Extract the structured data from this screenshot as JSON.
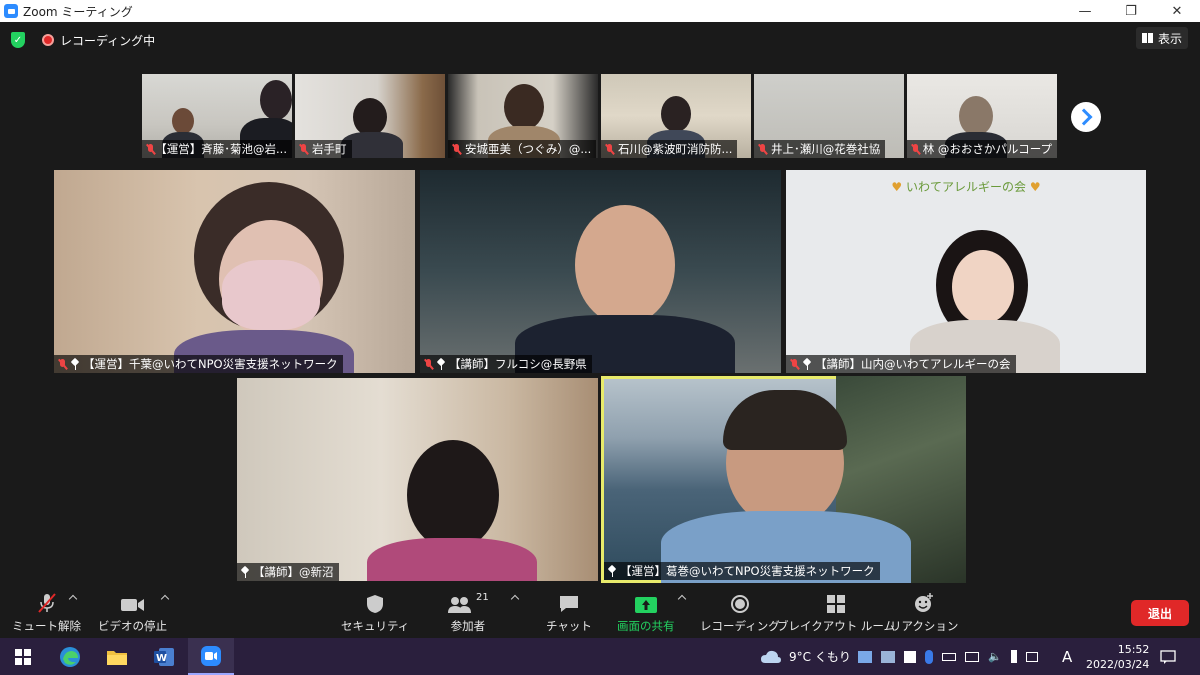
{
  "window": {
    "title": "Zoom ミーティング",
    "minimize": "—",
    "restore": "❐",
    "close": "✕"
  },
  "meeting_top": {
    "recording_label": "レコーディング中",
    "view_label": "表示"
  },
  "thumbnails": [
    {
      "name": "【運営】斉藤･菊池@岩...",
      "muted": true
    },
    {
      "name": "岩手町",
      "muted": true
    },
    {
      "name": "安城亜美（つぐみ）@...",
      "muted": true
    },
    {
      "name": "石川@紫波町消防防...",
      "muted": true
    },
    {
      "name": "井上･瀬川@花巻社協",
      "muted": true
    },
    {
      "name": "林 @おおさかパルコープ",
      "muted": true
    }
  ],
  "tiles": [
    {
      "name": "【運営】千葉@いわてNPO災害支援ネットワーク",
      "muted": true,
      "pinned": true
    },
    {
      "name": "【講師】フルコシ@長野県",
      "muted": true,
      "pinned": true
    },
    {
      "name": "【講師】山内@いわてアレルギーの会",
      "muted": true,
      "pinned": true,
      "banner": "いわてアレルギーの会"
    },
    {
      "name": "【講師】@新沼",
      "muted": false,
      "pinned": true
    },
    {
      "name": "【運営】葛巻@いわてNPO災害支援ネットワーク",
      "muted": false,
      "pinned": true,
      "active_speaker": true
    }
  ],
  "toolbar": {
    "unmute": "ミュート解除",
    "stop_video": "ビデオの停止",
    "security": "セキュリティ",
    "participants": "参加者",
    "participants_count": "21",
    "chat": "チャット",
    "share_screen": "画面の共有",
    "recording": "レコーディング",
    "breakout": "ブレイクアウト ルーム",
    "reactions": "リアクション",
    "leave": "退出"
  },
  "taskbar": {
    "weather": "9°C くもり",
    "ime": "A",
    "time": "15:52",
    "date": "2022/03/24"
  },
  "colors": {
    "zoom_blue": "#2D8CFF",
    "leave_red": "#E02828",
    "share_green": "#23D160",
    "active_speaker": "#E8EB6B"
  }
}
